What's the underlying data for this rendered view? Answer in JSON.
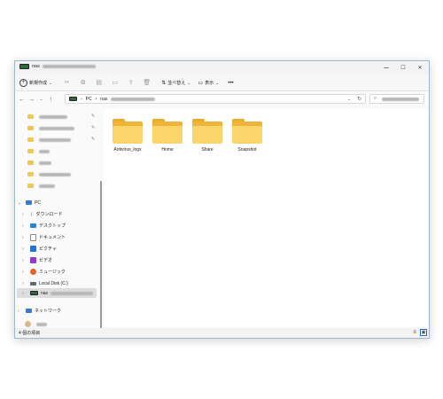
{
  "window": {
    "title": "nas",
    "controls": {
      "minimize": "─",
      "maximize": "☐",
      "close": "✕"
    }
  },
  "toolbar": {
    "new_label": "新規作成",
    "new_icon": "plus-circle-icon",
    "sort_label": "並べ替え",
    "view_label": "表示",
    "more_label": "•••"
  },
  "address": {
    "pc_label": "PC",
    "nas_label": "nas",
    "separator": "›",
    "search_placeholder": ""
  },
  "sidebar": {
    "quick_access": [
      {
        "label": "",
        "pinned": true
      },
      {
        "label": "",
        "pinned": true
      },
      {
        "label": "",
        "pinned": true
      },
      {
        "label": "",
        "pinned": false
      },
      {
        "label": "",
        "pinned": false
      },
      {
        "label": "",
        "pinned": false
      },
      {
        "label": "",
        "pinned": false
      }
    ],
    "pc_label": "PC",
    "pc_items": [
      {
        "label": "ダウンロード",
        "icon": "download-icon",
        "color": "#2e7d32"
      },
      {
        "label": "デスクトップ",
        "icon": "desktop-icon",
        "color": "#2f7fd1"
      },
      {
        "label": "ドキュメント",
        "icon": "document-icon",
        "color": "#8a8a8a"
      },
      {
        "label": "ピクチャ",
        "icon": "picture-icon",
        "color": "#2a6fd6"
      },
      {
        "label": "ビデオ",
        "icon": "video-icon",
        "color": "#8d3ec9"
      },
      {
        "label": "ミュージック",
        "icon": "music-icon",
        "color": "#e0642c"
      },
      {
        "label": "Local Disk (C:)",
        "icon": "disk-icon",
        "color": "#5a6b78"
      },
      {
        "label": "nas",
        "icon": "nas-drive-icon",
        "color": "#2f6b3a"
      }
    ],
    "network_label": "ネットワーク",
    "network_icon_color": "#2f7fd1",
    "user_label": ""
  },
  "folders": [
    {
      "name": "Antivirus_logs"
    },
    {
      "name": "Home"
    },
    {
      "name": "Share"
    },
    {
      "name": "Snapshot"
    }
  ],
  "status": {
    "item_count": "4 個の項目"
  },
  "colors": {
    "folder_front": "#fbd46a",
    "folder_back": "#eeb43a",
    "accent": "#1a73c9"
  }
}
